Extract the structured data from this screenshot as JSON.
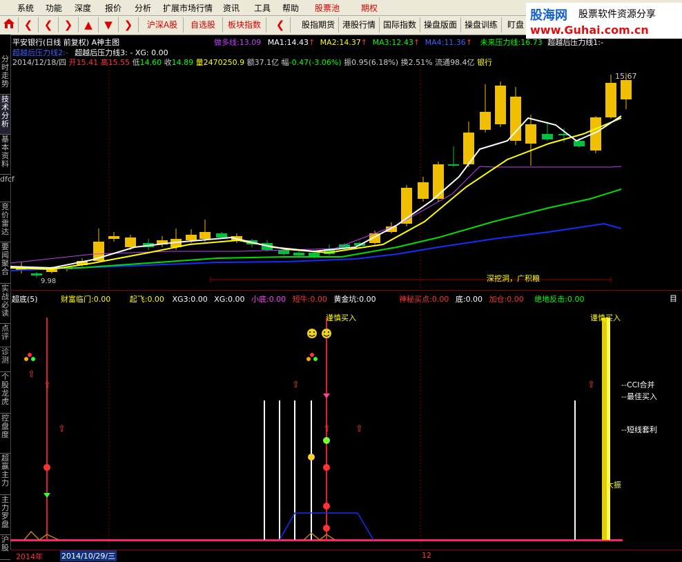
{
  "menu": {
    "items": [
      "系统",
      "功能",
      "深度",
      "报价",
      "分析",
      "扩展市场行情",
      "资讯",
      "工具",
      "帮助"
    ],
    "stock_pool": "股票池",
    "futures": "期权"
  },
  "logo": {
    "brand": "股海网",
    "slogan": "股票软件资源分享",
    "url": "www.Guhai.com.cn"
  },
  "toolbar": {
    "home_icon": "home-icon",
    "items": [
      "沪深A股",
      "自选股",
      "板块指数",
      "股指期货",
      "港股行情",
      "国际指数",
      "操盘版面",
      "操盘训练",
      "盯盘"
    ]
  },
  "sidebar": {
    "tabs": [
      "分时走势",
      "技术分析",
      "基本资料",
      "dfcf",
      "竞价雷达",
      "要闻聚合",
      "实战必读",
      "点评",
      "诊测",
      "个股龙虎",
      "控盘度",
      "超赢主力",
      "主力罗盘",
      "沪股"
    ]
  },
  "chart_header": {
    "title": "平安银行(日线 前复权) A神主图",
    "indicators": [
      {
        "label": "做多线:",
        "value": "13.09",
        "color": "#c040ff"
      },
      {
        "label": "MA1:",
        "value": "14.43",
        "color": "#ffffff"
      },
      {
        "label": "MA2:",
        "value": "14.37",
        "color": "#ffff00"
      },
      {
        "label": "MA3:",
        "value": "12.43",
        "color": "#00ff00"
      },
      {
        "label": "MA4:",
        "value": "11.36",
        "color": "#4060ff"
      },
      {
        "label": "未来压力线:",
        "value": "16.73",
        "color": "#00ff00"
      },
      {
        "label": "超越后压力线1:",
        "value": "-",
        "color": "#ffffff"
      }
    ],
    "line2_a": "超越后压力线2:-",
    "line2_b": "超越后压力线3: -  XG: 0.00",
    "quote": {
      "date": "2014/12/18/四",
      "open_label": "开",
      "open": "15.41",
      "high_label": "高",
      "high": "15.55",
      "low_label": "低",
      "low": "14.60",
      "close_label": "收",
      "close": "14.89",
      "vol_label": "量",
      "vol": "2470250.9",
      "amt_label": "额",
      "amt": "37.1亿",
      "chg_label": "幅",
      "chg": "-0.47(-3.06%)",
      "amp_label": "振",
      "amp": "0.95(6.18%)",
      "turn_label": "换",
      "turn": "2.51%",
      "float_label": "流通",
      "float": "98.4亿",
      "sector": "银行"
    }
  },
  "main_chart": {
    "price_high_label": "15.67",
    "price_low_label": "9.98",
    "bottom_annotation": "深挖洞，广积粮"
  },
  "sub_header": {
    "name": "超底(5)",
    "items": [
      {
        "label": "财富临门:",
        "value": "0.00",
        "color": "#ffff00"
      },
      {
        "label": "起飞:",
        "value": "0.00",
        "color": "#ffff00"
      },
      {
        "label": "XG3:",
        "value": "0.00",
        "color": "#ffffff"
      },
      {
        "label": "XG:",
        "value": "0.00",
        "color": "#ffffff"
      },
      {
        "label": "小底:",
        "value": "0.00",
        "color": "#ff40ff"
      },
      {
        "label": "短牛:",
        "value": "0.00",
        "color": "#ff3030"
      },
      {
        "label": "黄金坑:",
        "value": "0.00",
        "color": "#ffffff"
      },
      {
        "label": "神秘买点:",
        "value": "0.00",
        "color": "#ff3030"
      },
      {
        "label": "底:",
        "value": "0.00",
        "color": "#ffffff"
      },
      {
        "label": "加仓:",
        "value": "0.00",
        "color": "#ff3030"
      },
      {
        "label": "绝地反击:",
        "value": "0.00",
        "color": "#00ff00"
      }
    ],
    "right_tab": "目"
  },
  "sub_chart": {
    "buy_label_1": "谨慎买入",
    "buy_label_2": "谨慎买入",
    "notes": [
      "--CCI合并",
      "--最佳买入",
      "--短线套利"
    ],
    "yellow_bar_text": "大振"
  },
  "time_axis": {
    "year": "2014年",
    "date": "2014/10/29/三",
    "tick12": "12"
  },
  "colors": {
    "rise": "#ff3030",
    "fall": "#00ffff",
    "bg": "#000000",
    "ma1": "#ffffff",
    "ma2": "#ffff00",
    "ma3": "#00e000",
    "ma4": "#1030ff",
    "pressure": "#c040ff"
  }
}
